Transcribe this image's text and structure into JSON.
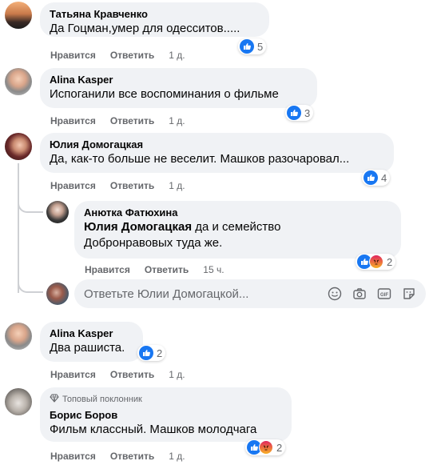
{
  "comments": [
    {
      "author": "Татьяна Кравченко",
      "text": "Да Гоцман,умер для одесситов.....",
      "like_label": "Нравится",
      "reply_label": "Ответить",
      "time": "1 д.",
      "reactions": "5"
    },
    {
      "author": "Alina Kasper",
      "text": "Испоганили все воспоминания о фильме",
      "like_label": "Нравится",
      "reply_label": "Ответить",
      "time": "1 д.",
      "reactions": "3"
    },
    {
      "author": "Юлия Домогацкая",
      "text": "Да, как-то больше не веселит. Машков разочаровал...",
      "like_label": "Нравится",
      "reply_label": "Ответить",
      "time": "1 д.",
      "reactions": "4"
    },
    {
      "author": "Alina Kasper",
      "text": "Два рашиста.",
      "like_label": "Нравится",
      "reply_label": "Ответить",
      "time": "1 д.",
      "reactions": "2"
    },
    {
      "badge": "Топовый поклонник",
      "author": "Борис Боров",
      "text": "Фильм классный. Машков молодчага",
      "like_label": "Нравится",
      "reply_label": "Ответить",
      "time": "1 д.",
      "reactions": "2"
    }
  ],
  "reply": {
    "author": "Анютка Фатюхина",
    "mention": "Юлия Домогацкая",
    "text_line1": "да и семейство",
    "text_line2": "Добронравовых туда же.",
    "like_label": "Нравится",
    "reply_label": "Ответить",
    "time": "15 ч.",
    "reactions": "2"
  },
  "reply_input": {
    "placeholder": "Ответьте Юлии Домогацкой..."
  },
  "colors": {
    "like_blue": "#1877f2",
    "bubble_bg": "#f0f2f5",
    "meta_gray": "#65676b"
  }
}
